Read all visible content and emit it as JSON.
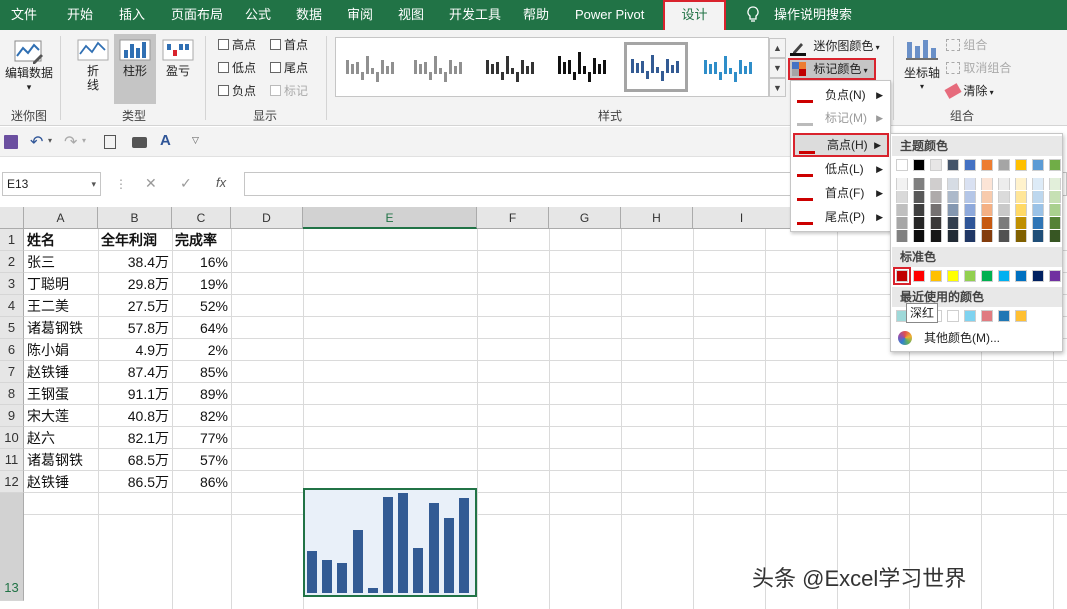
{
  "tabs": [
    {
      "label": "文件"
    },
    {
      "label": "开始"
    },
    {
      "label": "插入"
    },
    {
      "label": "页面布局"
    },
    {
      "label": "公式"
    },
    {
      "label": "数据"
    },
    {
      "label": "审阅"
    },
    {
      "label": "视图"
    },
    {
      "label": "开发工具"
    },
    {
      "label": "帮助"
    },
    {
      "label": "Power Pivot"
    },
    {
      "label": "设计"
    }
  ],
  "tell_me": "操作说明搜索",
  "ribbon": {
    "edit_data": "编辑数据",
    "group_sparkline": "迷你图",
    "line": "折线",
    "column": "柱形",
    "winloss": "盈亏",
    "group_type": "类型",
    "chk_high": "高点",
    "chk_first": "首点",
    "chk_low": "低点",
    "chk_last": "尾点",
    "chk_negative": "负点",
    "chk_markers": "标记",
    "group_show": "显示",
    "group_style": "样式",
    "sparkline_color": "迷你图颜色",
    "marker_color": "标记颜色",
    "axis": "坐标轴",
    "group_btn": "组合",
    "ungroup_btn": "取消组合",
    "clear": "清除",
    "group_group": "组合"
  },
  "namebox": "E13",
  "columns": [
    "A",
    "B",
    "C",
    "D",
    "E",
    "F",
    "G",
    "H",
    "I"
  ],
  "rows": [
    "1",
    "2",
    "3",
    "4",
    "5",
    "6",
    "7",
    "8",
    "9",
    "10",
    "11",
    "12",
    "13"
  ],
  "table": {
    "header": [
      "姓名",
      "全年利润",
      "完成率"
    ],
    "data": [
      [
        "张三",
        "38.4万",
        "16%"
      ],
      [
        "丁聪明",
        "29.8万",
        "19%"
      ],
      [
        "王二美",
        "27.5万",
        "52%"
      ],
      [
        "诸葛钢铁",
        "57.8万",
        "64%"
      ],
      [
        "陈小娟",
        "4.9万",
        "2%"
      ],
      [
        "赵铁锤",
        "87.4万",
        "85%"
      ],
      [
        "王钢蛋",
        "91.1万",
        "89%"
      ],
      [
        "宋大莲",
        "40.8万",
        "82%"
      ],
      [
        "赵六",
        "82.1万",
        "77%"
      ],
      [
        "诸葛钢铁",
        "68.5万",
        "57%"
      ],
      [
        "赵铁锤",
        "86.5万",
        "86%"
      ]
    ]
  },
  "sparkline_values": [
    38.4,
    29.8,
    27.5,
    57.8,
    4.9,
    87.4,
    91.1,
    40.8,
    82.1,
    68.5,
    86.5
  ],
  "menu": {
    "negative": "负点(N)",
    "markers": "标记(M)",
    "high": "高点(H)",
    "low": "低点(L)",
    "first": "首点(F)",
    "last": "尾点(P)"
  },
  "palette": {
    "theme_label": "主题颜色",
    "standard_label": "标准色",
    "recent_label": "最近使用的颜色",
    "more_colors": "其他颜色(M)...",
    "tooltip": "深红",
    "theme_top": [
      "#ffffff",
      "#000000",
      "#e7e6e6",
      "#44546a",
      "#4472c4",
      "#ed7d31",
      "#a5a5a5",
      "#ffc000",
      "#5b9bd5",
      "#70ad47"
    ],
    "theme_shades": [
      [
        "#f2f2f2",
        "#7f7f7f",
        "#d0cece",
        "#d6dce4",
        "#d9e1f2",
        "#fce4d6",
        "#ededed",
        "#fff2cc",
        "#ddebf7",
        "#e2efda"
      ],
      [
        "#d9d9d9",
        "#595959",
        "#aeaaaa",
        "#acb9ca",
        "#b4c6e7",
        "#f8cbad",
        "#dbdbdb",
        "#ffe699",
        "#bdd7ee",
        "#c6e0b4"
      ],
      [
        "#bfbfbf",
        "#404040",
        "#757171",
        "#8497b0",
        "#8ea9db",
        "#f4b084",
        "#c9c9c9",
        "#ffd966",
        "#9bc2e6",
        "#a9d08e"
      ],
      [
        "#a6a6a6",
        "#262626",
        "#3a3838",
        "#333f4f",
        "#2f5597",
        "#c65911",
        "#7b7b7b",
        "#bf8f00",
        "#2f75b5",
        "#548235"
      ],
      [
        "#808080",
        "#0d0d0d",
        "#161616",
        "#222b35",
        "#203764",
        "#833c0c",
        "#525252",
        "#806000",
        "#1f4e78",
        "#375623"
      ]
    ],
    "standard": [
      "#c00000",
      "#ff0000",
      "#ffc000",
      "#ffff00",
      "#92d050",
      "#00b050",
      "#00b0f0",
      "#0070c0",
      "#002060",
      "#7030a0"
    ],
    "recent": [
      "#9fd9d9",
      "#ffffff",
      "#ffffff",
      "#ffffff",
      "#7fd3f0",
      "#e07b80",
      "#1f77b4",
      "#ffc033"
    ]
  },
  "watermark": "头条 @Excel学习世界"
}
